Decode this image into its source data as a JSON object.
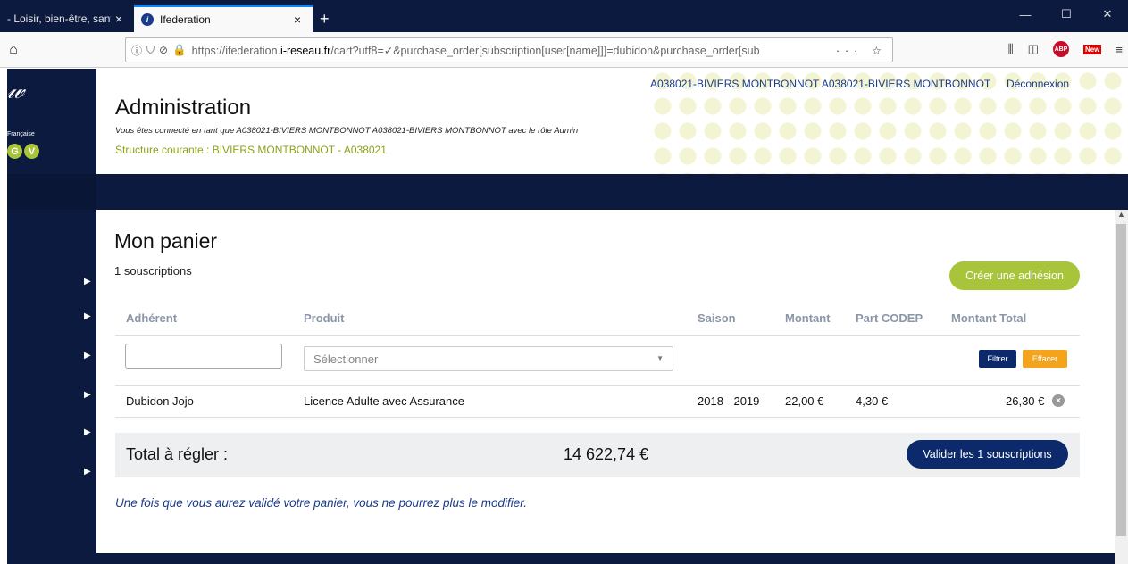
{
  "browser": {
    "tabs": [
      {
        "title": "- Loisir, bien-être, santé",
        "close": "×"
      },
      {
        "title": "Ifederation",
        "close": "×"
      }
    ],
    "new_tab": "+",
    "window_controls": {
      "minimize": "—",
      "maximize": "☐",
      "close": "✕"
    },
    "url_prefix": "https://ifederation.",
    "url_domain": "i-reseau.fr",
    "url_rest": "/cart?utf8=✓&purchase_order[subscription[user[name]]]=dubidon&purchase_order[sub",
    "url_dots": "··· ☆"
  },
  "header": {
    "user_link": "A038021-BIVIERS MONTBONNOT A038021-BIVIERS MONTBONNOT",
    "logout": "Déconnexion",
    "title": "Administration",
    "connected_as": "Vous êtes connecté en tant que A038021-BIVIERS MONTBONNOT A038021-BIVIERS MONTBONNOT avec le rôle Admin",
    "current_structure": "Structure courante : BIVIERS MONTBONNOT - A038021"
  },
  "logo": {
    "text": "Française",
    "letters": [
      "G",
      "V"
    ]
  },
  "cart": {
    "title": "Mon panier",
    "count": "1 souscriptions",
    "create_button": "Créer une adhésion",
    "columns": [
      "Adhérent",
      "Produit",
      "Saison",
      "Montant",
      "Part CODEP",
      "Montant Total"
    ],
    "select_placeholder": "Sélectionner",
    "filter_button": "Filtrer",
    "clear_button": "Effacer",
    "rows": [
      {
        "member": "Dubidon Jojo",
        "product": "Licence Adulte avec Assurance",
        "season": "2018 - 2019",
        "amount": "22,00 €",
        "codep": "4,30 €",
        "total": "26,30 €"
      }
    ],
    "total_label": "Total à régler :",
    "total_amount": "14 622,74 €",
    "validate_button": "Valider les 1 souscriptions",
    "note": "Une fois que vous aurez validé votre panier, vous ne pourrez plus le modifier."
  },
  "colors": {
    "navy": "#0c1a3f",
    "green": "#a8c43a",
    "orange": "#f4a41c",
    "link": "#1a3b8a"
  }
}
